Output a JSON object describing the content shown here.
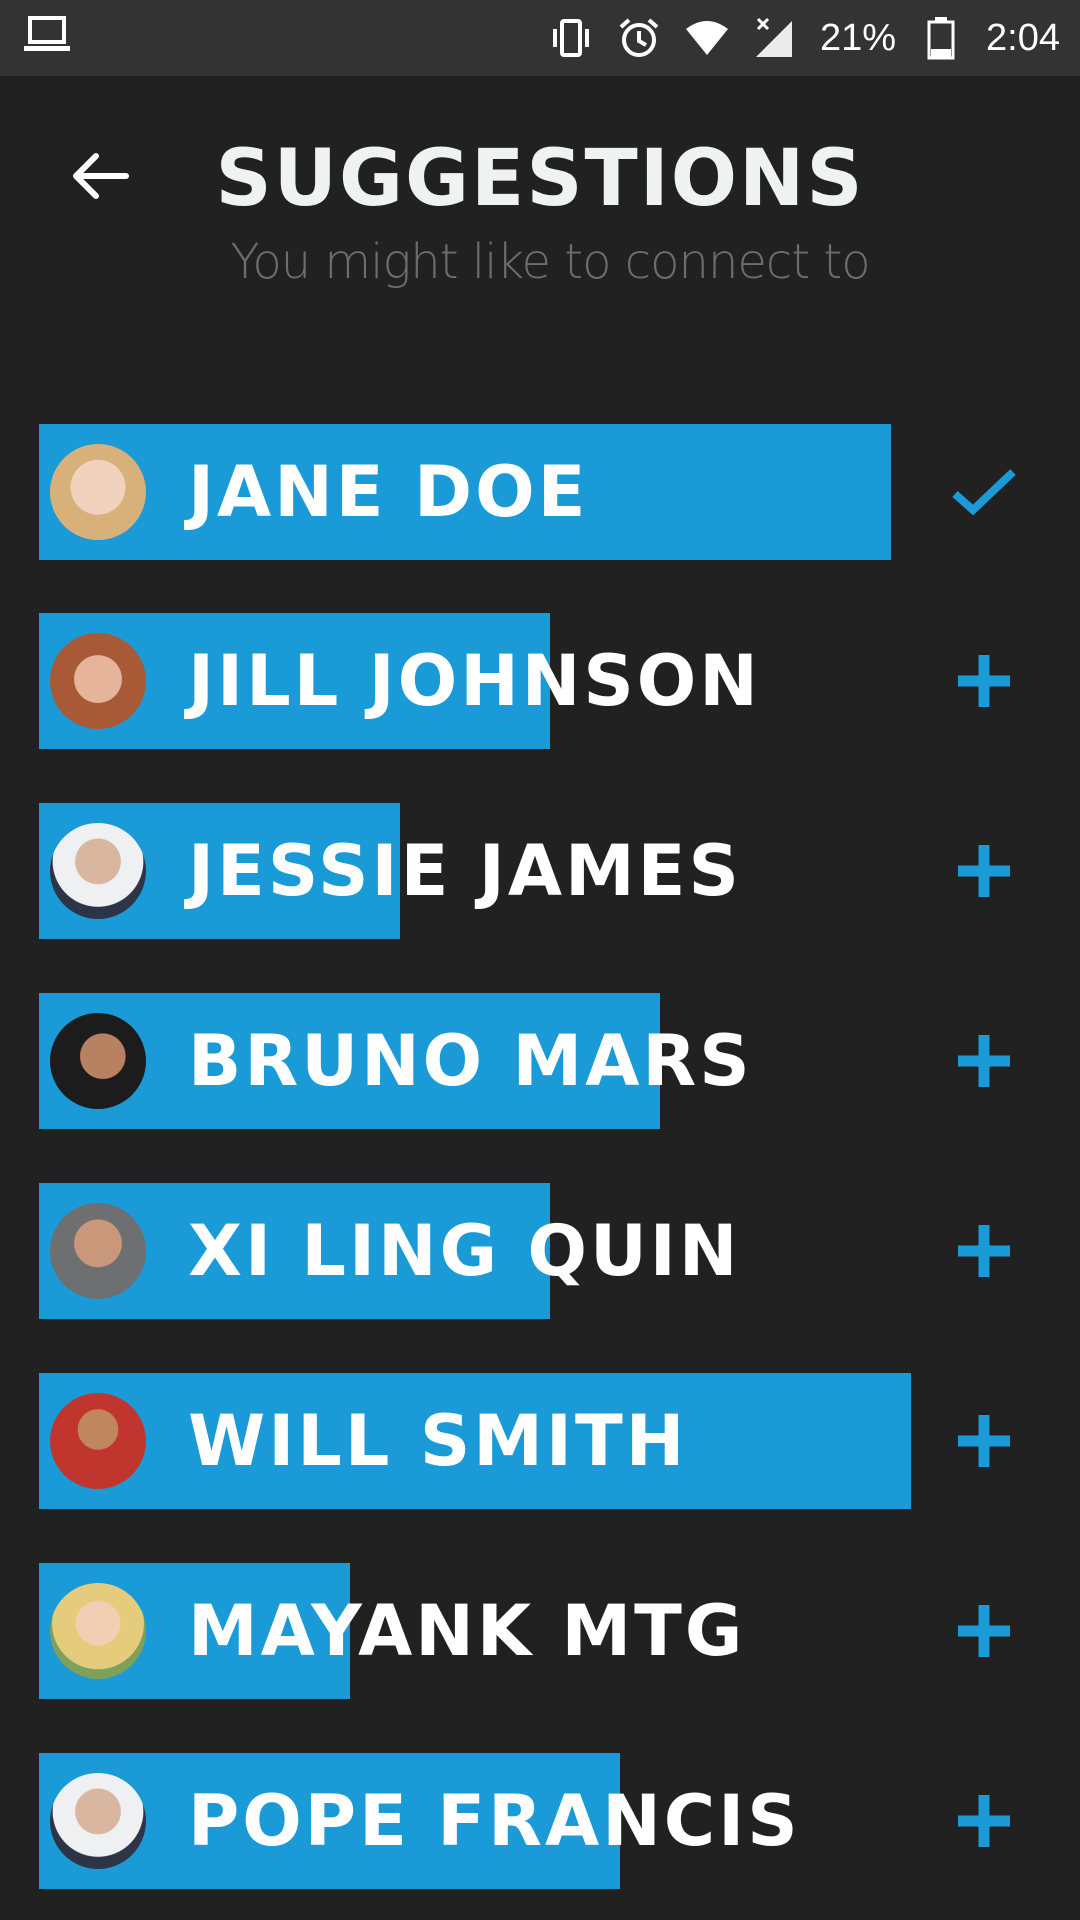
{
  "status_bar": {
    "battery": "21%",
    "time": "2:04",
    "icons": [
      "laptop-icon",
      "vibrate-icon",
      "alarm-icon",
      "wifi-icon",
      "signal-icon",
      "battery-icon"
    ]
  },
  "header": {
    "title": "SUGGESTIONS",
    "subtitle": "You might like to connect to"
  },
  "accent_color": "#1a9ad6",
  "suggestions": [
    {
      "name": "JANE DOE",
      "status": "added",
      "bar_fraction": 0.85
    },
    {
      "name": "JILL JOHNSON",
      "status": "add",
      "bar_fraction": 0.51
    },
    {
      "name": "JESSIE JAMES",
      "status": "add",
      "bar_fraction": 0.36
    },
    {
      "name": "BRUNO MARS",
      "status": "add",
      "bar_fraction": 0.62
    },
    {
      "name": "XI LING QUIN",
      "status": "add",
      "bar_fraction": 0.51
    },
    {
      "name": "WILL SMITH",
      "status": "add",
      "bar_fraction": 0.87
    },
    {
      "name": "MAYANK MTG",
      "status": "add",
      "bar_fraction": 0.31
    },
    {
      "name": "POPE FRANCIS",
      "status": "add",
      "bar_fraction": 0.58
    }
  ]
}
